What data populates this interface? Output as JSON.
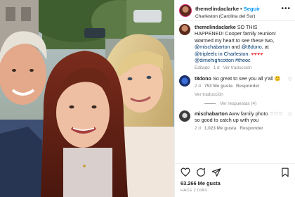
{
  "header": {
    "username": "themelindaclarke",
    "separator": "•",
    "follow_label": "Seguir",
    "location": "Charleston (Carolina del Sur)",
    "more_label": "•••"
  },
  "caption": {
    "username": "themelindaclarke",
    "text_parts": [
      "SO THIS HAPPENED! Cooper family reunion! Warmed my heart to see these two, ",
      " and ",
      ", at ",
      " in Charleston. ",
      " "
    ],
    "mentions": [
      "@mischabarton",
      "@t8dono",
      "@tripleelc in Charleston.",
      "@dimehighcotton"
    ],
    "hearts": "♥♥♥♥",
    "hashtag": "#theoc",
    "meta_edited": "Editado",
    "meta_time": "1 d",
    "translate_label": "Ver traducción"
  },
  "comments": [
    {
      "username": "t8dono",
      "text": "So great to see you all y'all",
      "emoji": "😊",
      "time": "2 d",
      "likes": "753 Me gusta",
      "reply_label": "Responder",
      "translate_label": "Ver traducción",
      "replies_label": "Ver respuestas (4)"
    },
    {
      "username": "mischabarton",
      "text": "Aww family photo",
      "text2": "so good to catch up with you",
      "hearts": "♡♡♡",
      "time": "2 d",
      "likes": "1.023 Me gusta",
      "reply_label": "Responder"
    }
  ],
  "footer": {
    "likes": "63.266 Me gusta",
    "when": "HACE 2 DÍAS"
  },
  "colors": {
    "accent": "#0095f6",
    "link": "#00376b",
    "muted": "#8e8e8e",
    "heart": "#ed4956"
  }
}
